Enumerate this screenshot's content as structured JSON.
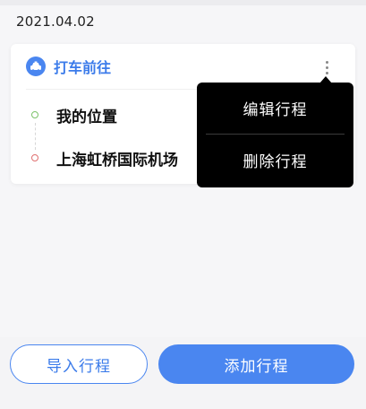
{
  "date": "2021.04.02",
  "colors": {
    "accent": "#4a86f0",
    "menu_bg": "#000000",
    "start_dot": "#7cc26a",
    "end_dot": "#e07070"
  },
  "trip": {
    "icon": "taxi-icon",
    "title": "打车前往",
    "from": "我的位置",
    "to": "上海虹桥国际机场"
  },
  "menu": {
    "edit_label": "编辑行程",
    "delete_label": "删除行程"
  },
  "actions": {
    "import_label": "导入行程",
    "add_label": "添加行程"
  }
}
